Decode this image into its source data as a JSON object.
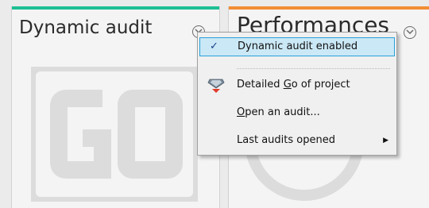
{
  "tiles": {
    "dynamic_audit": {
      "title": "Dynamic audit",
      "bar_color": "#1fbf94",
      "chevron_icon": "chevron-down-circle-icon",
      "background_art": "go-logo"
    },
    "performances": {
      "title": "Performances",
      "bar_color": "#f28d35",
      "chevron_icon": "chevron-down-circle-icon",
      "background_art": "gauge-icon"
    }
  },
  "context_menu": {
    "items": [
      {
        "id": "dynamic-audit-enabled",
        "label": "Dynamic audit enabled",
        "checked": true,
        "check_symbol": "✓"
      },
      {
        "id": "detailed-go",
        "label_before": "Detailed ",
        "label_accel": "G",
        "label_after": "o of project",
        "icon": "diamond-go-icon"
      },
      {
        "id": "open-audit",
        "label_accel": "O",
        "label_after": "pen an audit...",
        "icon": ""
      },
      {
        "id": "last-audits",
        "label": "Last audits opened",
        "submenu_arrow": "▶"
      }
    ]
  }
}
